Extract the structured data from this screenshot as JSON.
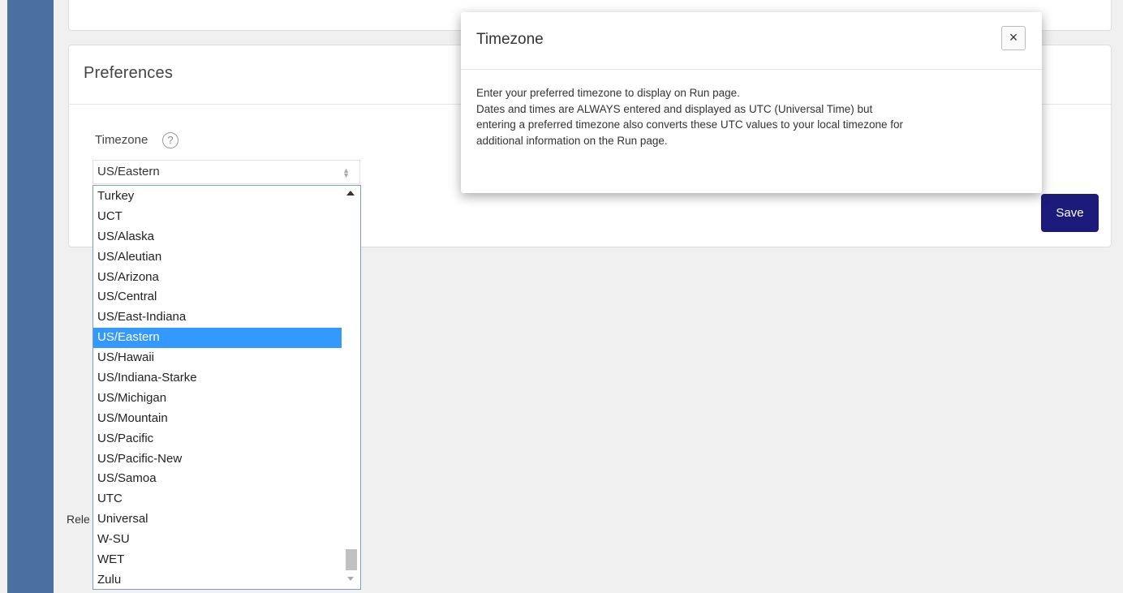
{
  "preferences": {
    "title": "Preferences",
    "timezone_label": "Timezone",
    "help_glyph": "?",
    "selected_value": "US/Eastern",
    "save_label": "Save",
    "partial_text": "Rele"
  },
  "timezone_list": {
    "options": [
      "Turkey",
      "UCT",
      "US/Alaska",
      "US/Aleutian",
      "US/Arizona",
      "US/Central",
      "US/East-Indiana",
      "US/Eastern",
      "US/Hawaii",
      "US/Indiana-Starke",
      "US/Michigan",
      "US/Mountain",
      "US/Pacific",
      "US/Pacific-New",
      "US/Samoa",
      "UTC",
      "Universal",
      "W-SU",
      "WET",
      "Zulu"
    ],
    "selected": "US/Eastern"
  },
  "modal": {
    "title": "Timezone",
    "close_glyph": "×",
    "body_lines": [
      "Enter your preferred timezone to display on Run page.",
      "Dates and times are ALWAYS entered and displayed as UTC (Universal Time) but",
      "entering a preferred timezone also converts these UTC values to your local timezone for",
      "additional information on the Run page."
    ]
  },
  "colors": {
    "sidebar": "#4a6fa0",
    "save_button": "#1c1a7a",
    "selection": "#3399ff"
  }
}
